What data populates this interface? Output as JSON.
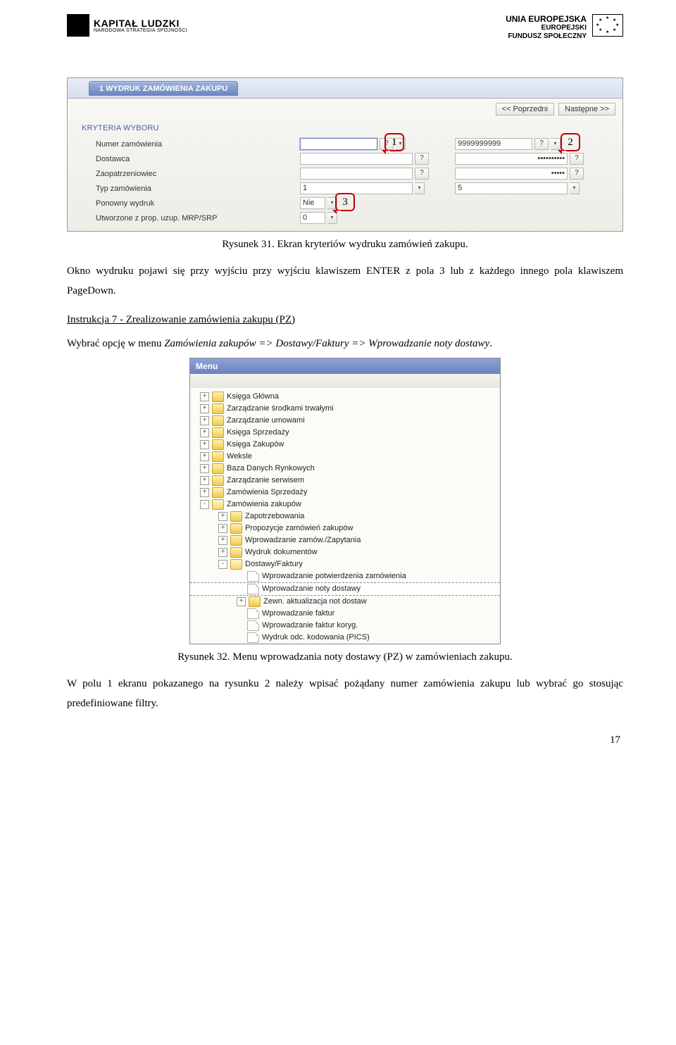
{
  "logos": {
    "left_line1": "KAPITAŁ LUDZKI",
    "left_line2": "NARODOWA STRATEGIA SPÓJNOŚCI",
    "right_line1": "UNIA EUROPEJSKA",
    "right_line2": "EUROPEJSKI",
    "right_line3": "FUNDUSZ SPOŁECZNY"
  },
  "shot1": {
    "tab": "1 WYDRUK ZAMÓWIENIA ZAKUPU",
    "nav_prev": "<< Poprzedni",
    "nav_next": "Następne >>",
    "section_title": "KRYTERIA WYBORU",
    "rows": {
      "numer_zam": "Numer zamówienia",
      "dostawca": "Dostawca",
      "zaopatrz": "Zaopatrzeniowiec",
      "typ_zam": "Typ zamówienia",
      "ponowny": "Ponowny wydruk",
      "utworzone": "Utworzone z prop. uzup. MRP/SRP"
    },
    "values": {
      "numer_l": "",
      "numer_r": "9999999999",
      "dostawca_l": "",
      "dostawca_r": "••••••••••",
      "zaop_l": "",
      "zaop_r": "•••••",
      "typ_l": "1",
      "typ_r": "5",
      "ponowny": "Nie",
      "utworzone": "0"
    },
    "callout1": "1",
    "callout2": "2",
    "callout3": "3"
  },
  "caption1": "Rysunek 31. Ekran kryteriów wydruku zamówień zakupu.",
  "para1": "Okno wydruku pojawi się przy wyjściu przy wyjściu klawiszem ENTER z pola 3 lub z każdego innego pola klawiszem PageDown.",
  "heading": "Instrukcja 7 - Zrealizowanie zamówienia zakupu (PZ)",
  "para2a": "Wybrać opcję w menu ",
  "para2b": "Zamówienia zakupów => Dostawy/Faktury => Wprowadzanie noty dostawy",
  "para2c": ".",
  "menu": {
    "title": "Menu",
    "items": [
      {
        "d": 0,
        "exp": "+",
        "type": "folder",
        "label": "Księga Główna"
      },
      {
        "d": 0,
        "exp": "+",
        "type": "folder",
        "label": "Zarządzanie środkami trwałymi"
      },
      {
        "d": 0,
        "exp": "+",
        "type": "folder",
        "label": "Zarządzanie umowami"
      },
      {
        "d": 0,
        "exp": "+",
        "type": "folder",
        "label": "Księga Sprzedaży"
      },
      {
        "d": 0,
        "exp": "+",
        "type": "folder",
        "label": "Księga Zakupów"
      },
      {
        "d": 0,
        "exp": "+",
        "type": "folder",
        "label": "Weksle"
      },
      {
        "d": 0,
        "exp": "+",
        "type": "folder",
        "label": "Baza Danych Rynkowych"
      },
      {
        "d": 0,
        "exp": "+",
        "type": "folder",
        "label": "Zarządzanie serwisem"
      },
      {
        "d": 0,
        "exp": "+",
        "type": "folder",
        "label": "Zamówienia Sprzedaży"
      },
      {
        "d": 0,
        "exp": "-",
        "type": "folder-open",
        "label": "Zamówienia zakupów"
      },
      {
        "d": 1,
        "exp": "+",
        "type": "folder",
        "label": "Zapotrzebowania"
      },
      {
        "d": 1,
        "exp": "+",
        "type": "folder",
        "label": "Propozycje zamówień zakupów"
      },
      {
        "d": 1,
        "exp": "+",
        "type": "folder",
        "label": "Wprowadzanie zamów./Zapytania"
      },
      {
        "d": 1,
        "exp": "+",
        "type": "folder",
        "label": "Wydruk dokumentów"
      },
      {
        "d": 1,
        "exp": "-",
        "type": "folder-open",
        "label": "Dostawy/Faktury"
      },
      {
        "d": 2,
        "exp": "",
        "type": "file",
        "label": "Wprowadzanie potwierdzenia zamówienia"
      },
      {
        "d": 2,
        "exp": "",
        "type": "file",
        "label": "Wprowadzanie noty dostawy",
        "sel": true
      },
      {
        "d": 2,
        "exp": "+",
        "type": "folder",
        "label": "Zewn. aktualizacja not dostaw"
      },
      {
        "d": 2,
        "exp": "",
        "type": "file",
        "label": "Wprowadzanie faktur"
      },
      {
        "d": 2,
        "exp": "",
        "type": "file",
        "label": "Wprowadzanie faktur koryg."
      },
      {
        "d": 2,
        "exp": "",
        "type": "file",
        "label": "Wydruk odc. kodowania (PICS)"
      }
    ]
  },
  "caption2": "Rysunek 32. Menu wprowadzania noty dostawy (PZ) w zamówieniach zakupu.",
  "para3": "W polu 1 ekranu pokazanego na rysunku 2 należy wpisać pożądany numer zamówienia zakupu lub wybrać go stosując predefiniowane filtry.",
  "page_num": "17"
}
